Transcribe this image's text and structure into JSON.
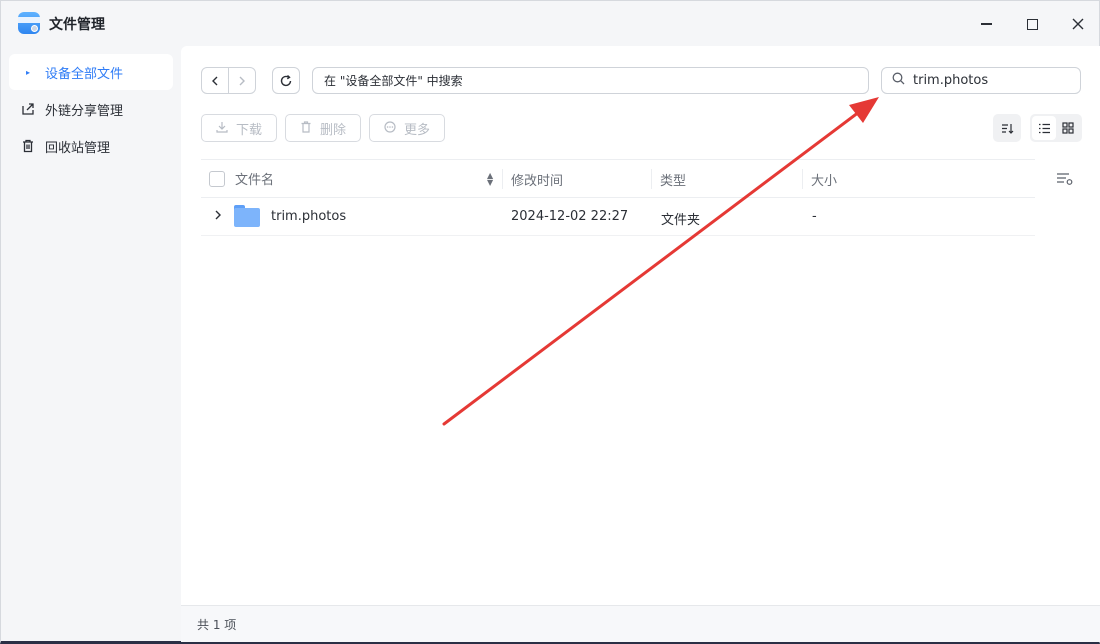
{
  "window": {
    "title": "文件管理",
    "controls": {
      "minimize": "–",
      "maximize": "□",
      "close": "✕"
    }
  },
  "sidebar": {
    "items": [
      {
        "label": "设备全部文件",
        "icon": "bullet-icon",
        "active": true
      },
      {
        "label": "外链分享管理",
        "icon": "share-link-icon",
        "active": false
      },
      {
        "label": "回收站管理",
        "icon": "trash-icon",
        "active": false
      }
    ]
  },
  "toolbar": {
    "back": "‹",
    "forward": "›",
    "refresh": "⟳",
    "path_text": "在 \"设备全部文件\" 中搜索",
    "search_value": "trim.photos",
    "download_label": "下载",
    "delete_label": "删除",
    "more_label": "更多"
  },
  "table": {
    "columns": [
      "文件名",
      "修改时间",
      "类型",
      "大小"
    ],
    "rows": [
      {
        "name": "trim.photos",
        "mtime": "2024-12-02 22:27",
        "type": "文件夹",
        "size": "-"
      }
    ]
  },
  "status": {
    "count_text": "共 1 项"
  },
  "colors": {
    "accent": "#2f7cf6",
    "arrow": "#e53935",
    "folder": "#7db4fb"
  }
}
